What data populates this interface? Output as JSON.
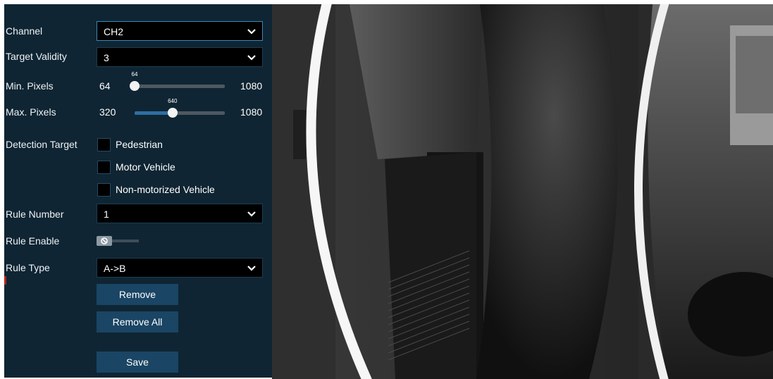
{
  "form": {
    "channel": {
      "label": "Channel",
      "value": "CH2"
    },
    "target_validity": {
      "label": "Target Validity",
      "value": "3"
    },
    "min_pixels": {
      "label": "Min. Pixels",
      "min": "64",
      "max": "1080",
      "value": "64",
      "fraction": 0.0
    },
    "max_pixels": {
      "label": "Max. Pixels",
      "min": "320",
      "max": "1080",
      "value": "640",
      "fraction": 0.42
    },
    "detection_target": {
      "label": "Detection Target",
      "options": [
        {
          "label": "Pedestrian",
          "checked": false
        },
        {
          "label": "Motor Vehicle",
          "checked": false
        },
        {
          "label": "Non-motorized Vehicle",
          "checked": false
        }
      ]
    },
    "rule_number": {
      "label": "Rule Number",
      "value": "1"
    },
    "rule_enable": {
      "label": "Rule Enable",
      "enabled": false
    },
    "rule_type": {
      "label": "Rule Type",
      "value": "A->B"
    },
    "buttons": {
      "remove": "Remove",
      "remove_all": "Remove All",
      "save": "Save"
    }
  },
  "colors": {
    "panel": "#0f2533",
    "button": "#1a4564",
    "slider_fill": "#2e6ea3",
    "focus_border": "#3e86b8"
  },
  "icons": {
    "dropdown": "chevron-down-icon",
    "toggle_off": "disabled-icon"
  }
}
